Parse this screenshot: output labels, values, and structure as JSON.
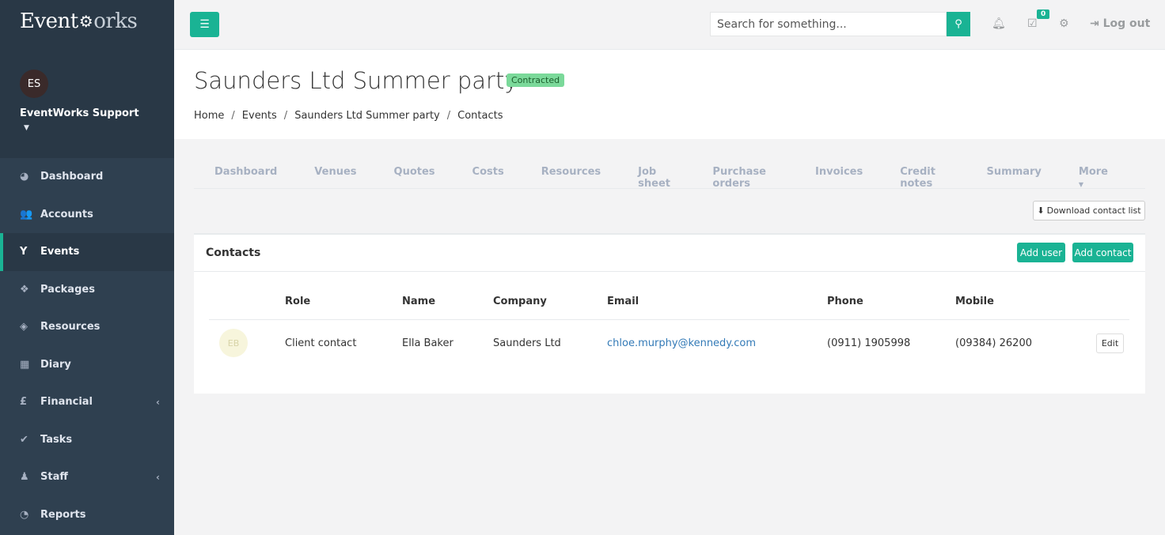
{
  "app": {
    "logo_prefix": "Event",
    "logo_suffix": "orks"
  },
  "profile": {
    "initials": "ES",
    "name": "EventWorks Support"
  },
  "sidebar": {
    "items": [
      {
        "label": "Dashboard",
        "icon": "dashboard-icon"
      },
      {
        "label": "Accounts",
        "icon": "users-icon"
      },
      {
        "label": "Events",
        "icon": "glass-icon"
      },
      {
        "label": "Packages",
        "icon": "cubes-icon"
      },
      {
        "label": "Resources",
        "icon": "cube-icon"
      },
      {
        "label": "Diary",
        "icon": "calendar-icon"
      },
      {
        "label": "Financial",
        "icon": "pound-icon"
      },
      {
        "label": "Tasks",
        "icon": "check-icon"
      },
      {
        "label": "Staff",
        "icon": "user-icon"
      },
      {
        "label": "Reports",
        "icon": "pie-chart-icon"
      }
    ]
  },
  "topbar": {
    "search_placeholder": "Search for something...",
    "task_count": "0",
    "logout_label": "Log out"
  },
  "heading": {
    "title": "Saunders Ltd Summer party",
    "status": "Contracted",
    "breadcrumb": [
      "Home",
      "Events",
      "Saunders Ltd Summer party",
      "Contacts"
    ]
  },
  "tabs": [
    "Dashboard",
    "Venues",
    "Quotes",
    "Costs",
    "Resources",
    "Job sheet",
    "Purchase orders",
    "Invoices",
    "Credit notes",
    "Summary",
    "More"
  ],
  "download_label": "Download contact list",
  "contacts": {
    "title": "Contacts",
    "add_user_label": "Add user",
    "add_contact_label": "Add contact",
    "columns": [
      "Role",
      "Name",
      "Company",
      "Email",
      "Phone",
      "Mobile"
    ],
    "rows": [
      {
        "initials": "EB",
        "role": "Client contact",
        "name": "Ella Baker",
        "company": "Saunders Ltd",
        "email": "chloe.murphy@kennedy.com",
        "phone": "(0911) 1905998",
        "mobile": "(09384) 26200",
        "edit_label": "Edit"
      }
    ]
  },
  "colors": {
    "accent": "#1ab394",
    "sidebar_bg": "#2f4050",
    "status_badge": "#7bd99a"
  }
}
